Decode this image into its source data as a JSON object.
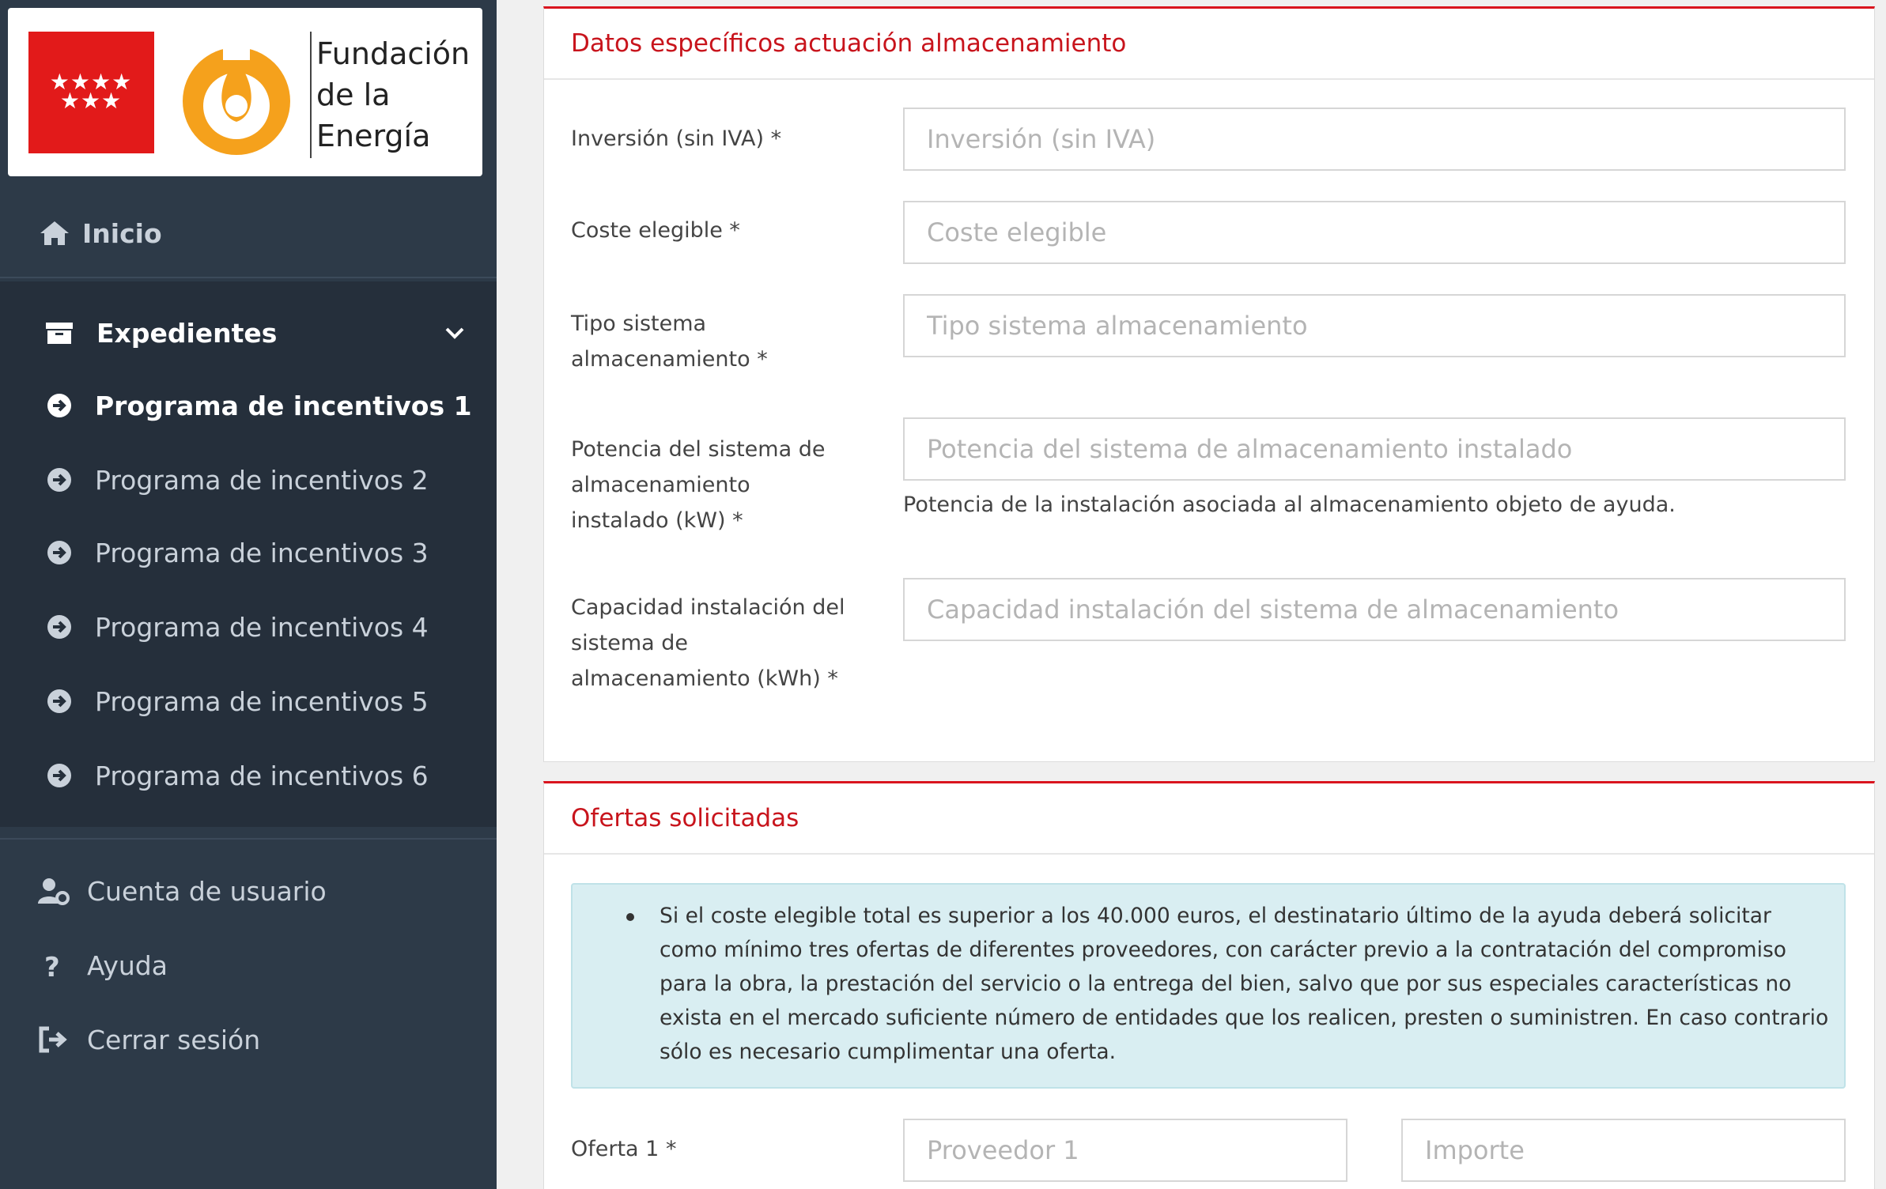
{
  "brand": {
    "stars": "★★★★\n★★★",
    "logo_text": [
      "Fundación",
      "de la",
      "Energía"
    ],
    "flag_color": "#e21a1a",
    "mark_color": "#f5a11c"
  },
  "sidebar": {
    "home_label": "Inicio",
    "group_label": "Expedientes",
    "items": [
      {
        "label": "Programa de incentivos 1",
        "active": true
      },
      {
        "label": "Programa de incentivos 2",
        "active": false
      },
      {
        "label": "Programa de incentivos 3",
        "active": false
      },
      {
        "label": "Programa de incentivos 4",
        "active": false
      },
      {
        "label": "Programa de incentivos 5",
        "active": false
      },
      {
        "label": "Programa de incentivos 6",
        "active": false
      }
    ],
    "bottom": [
      {
        "label": "Cuenta de usuario",
        "icon": "user-cog-icon"
      },
      {
        "label": "Ayuda",
        "icon": "question-icon"
      },
      {
        "label": "Cerrar sesión",
        "icon": "sign-out-icon"
      }
    ]
  },
  "section1": {
    "title": "Datos específicos actuación almacenamiento",
    "fields": [
      {
        "label": "Inversión (sin IVA) *",
        "placeholder": "Inversión (sin IVA)",
        "value": ""
      },
      {
        "label": "Coste elegible *",
        "placeholder": "Coste elegible",
        "value": ""
      },
      {
        "label_lines": [
          "Tipo sistema",
          "almacenamiento *"
        ],
        "placeholder": "Tipo sistema almacenamiento",
        "value": ""
      },
      {
        "label_lines": [
          "Potencia del sistema de",
          "almacenamiento",
          "instalado (kW) *"
        ],
        "placeholder": "Potencia del sistema de almacenamiento instalado",
        "value": "",
        "help": "Potencia de la instalación asociada al almacenamiento objeto de ayuda."
      },
      {
        "label_lines": [
          "Capacidad instalación del",
          "sistema de",
          "almacenamiento (kWh) *"
        ],
        "placeholder": "Capacidad instalación del sistema de almacenamiento",
        "value": ""
      }
    ]
  },
  "section2": {
    "title": "Ofertas solicitadas",
    "info": "Si el coste elegible total es superior a los 40.000 euros, el destinatario último de la ayuda deberá solicitar como mínimo tres ofertas de diferentes proveedores, con carácter previo a la contratación del compromiso para la obra, la prestación del servicio o la entrega del bien, salvo que por sus especiales características no exista en el mercado suficiente número de entidades que los realicen, presten o suministren. En caso contrario sólo es necesario cumplimentar una oferta.",
    "offer1": {
      "label": "Oferta 1 *",
      "provider_placeholder": "Proveedor 1",
      "amount_placeholder": "Importe"
    }
  }
}
